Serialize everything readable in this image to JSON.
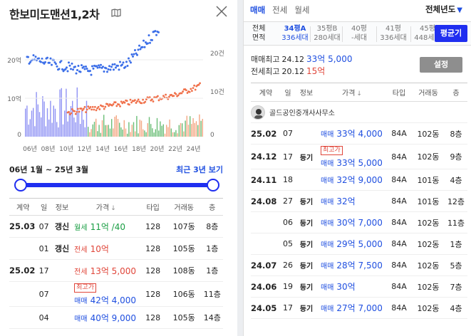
{
  "left": {
    "title": "한보미도맨션1,2차",
    "chart": {
      "y_left_ticks": [
        "20억",
        "10억",
        "0"
      ],
      "y_right_ticks": [
        "20건",
        "10건",
        "0"
      ],
      "x_ticks": [
        "06년",
        "08년",
        "10년",
        "12년",
        "14년",
        "16년",
        "18년",
        "20년",
        "22년",
        "24년"
      ]
    },
    "range_label": "06년 1월 ~ 25년 3월",
    "recent_button": "최근 3년 보기",
    "headers": [
      "계약",
      "일",
      "정보",
      "가격",
      "타입",
      "거래동",
      "층"
    ],
    "sort_mark": "↓",
    "rows": [
      {
        "date": "25.03",
        "day": "07",
        "info": "갱신",
        "kind": "월세",
        "kind_class": "w",
        "tag": "",
        "price": "11억 /40",
        "type": "128",
        "dong": "107동",
        "floor": "8층"
      },
      {
        "date": "",
        "day": "01",
        "info": "갱신",
        "kind": "전세",
        "kind_class": "j",
        "tag": "",
        "price": "10억",
        "type": "128",
        "dong": "105동",
        "floor": "1층"
      },
      {
        "date": "25.02",
        "day": "17",
        "info": "",
        "kind": "전세",
        "kind_class": "j",
        "tag": "",
        "price": "13억 5,000",
        "type": "128",
        "dong": "108동",
        "floor": "1층"
      },
      {
        "date": "",
        "day": "07",
        "info": "",
        "kind": "매매",
        "kind_class": "m",
        "tag": "최고가",
        "price": "42억 4,000",
        "type": "128",
        "dong": "106동",
        "floor": "11층"
      },
      {
        "date": "",
        "day": "04",
        "info": "",
        "kind": "매매",
        "kind_class": "m",
        "tag": "",
        "price": "40억 9,000",
        "type": "128",
        "dong": "105동",
        "floor": "14층"
      }
    ]
  },
  "right": {
    "tabs": [
      "매매",
      "전세",
      "월세"
    ],
    "year_select": "전체년도",
    "size_label": [
      "전체",
      "면적"
    ],
    "sizes": [
      {
        "a": "34평A",
        "b": "336세대",
        "selected": true
      },
      {
        "a": "35평B",
        "b": "280세대",
        "selected": false
      },
      {
        "a": "40평",
        "b": "-세대",
        "selected": false
      },
      {
        "a": "41평",
        "b": "336세대",
        "selected": false
      },
      {
        "a": "45평",
        "b": "448세대",
        "selected": false
      }
    ],
    "avg_button": "평균기",
    "max_sale": {
      "label": "매매최고",
      "date": "24.12",
      "price": "33억 5,000"
    },
    "max_jeonse": {
      "label": "전세최고",
      "date": "20.12",
      "price": "15억"
    },
    "setting_button": "설정",
    "headers": [
      "계약",
      "일",
      "정보",
      "가격",
      "타입",
      "거래동",
      "층"
    ],
    "sort_mark": "↓",
    "agent_name": "골드공인중개사사무소",
    "rows": [
      {
        "date": "25.02",
        "day": "07",
        "info": "",
        "tag": "",
        "kind": "매매",
        "price": "33억 4,000",
        "type": "84A",
        "dong": "102동",
        "floor": "8층"
      },
      {
        "date": "24.12",
        "day": "17",
        "info": "등기",
        "tag": "최고가",
        "kind": "매매",
        "price": "33억 5,000",
        "type": "84A",
        "dong": "102동",
        "floor": "9층"
      },
      {
        "date": "24.11",
        "day": "18",
        "info": "",
        "tag": "",
        "kind": "매매",
        "price": "32억 9,000",
        "type": "84A",
        "dong": "101동",
        "floor": "4층"
      },
      {
        "date": "24.08",
        "day": "27",
        "info": "등기",
        "tag": "",
        "kind": "매매",
        "price": "32억",
        "type": "84A",
        "dong": "101동",
        "floor": "12층"
      },
      {
        "date": "",
        "day": "06",
        "info": "등기",
        "tag": "",
        "kind": "매매",
        "price": "30억 7,000",
        "type": "84A",
        "dong": "102동",
        "floor": "11층"
      },
      {
        "date": "",
        "day": "05",
        "info": "등기",
        "tag": "",
        "kind": "매매",
        "price": "29억 5,000",
        "type": "84A",
        "dong": "102동",
        "floor": "1층"
      },
      {
        "date": "24.07",
        "day": "26",
        "info": "등기",
        "tag": "",
        "kind": "매매",
        "price": "28억 7,500",
        "type": "84A",
        "dong": "102동",
        "floor": "5층"
      },
      {
        "date": "24.06",
        "day": "19",
        "info": "등기",
        "tag": "",
        "kind": "매매",
        "price": "30억",
        "type": "84A",
        "dong": "102동",
        "floor": "7층"
      },
      {
        "date": "24.05",
        "day": "17",
        "info": "등기",
        "tag": "",
        "kind": "매매",
        "price": "27억 7,000",
        "type": "84A",
        "dong": "102동",
        "floor": "4층"
      }
    ]
  }
}
